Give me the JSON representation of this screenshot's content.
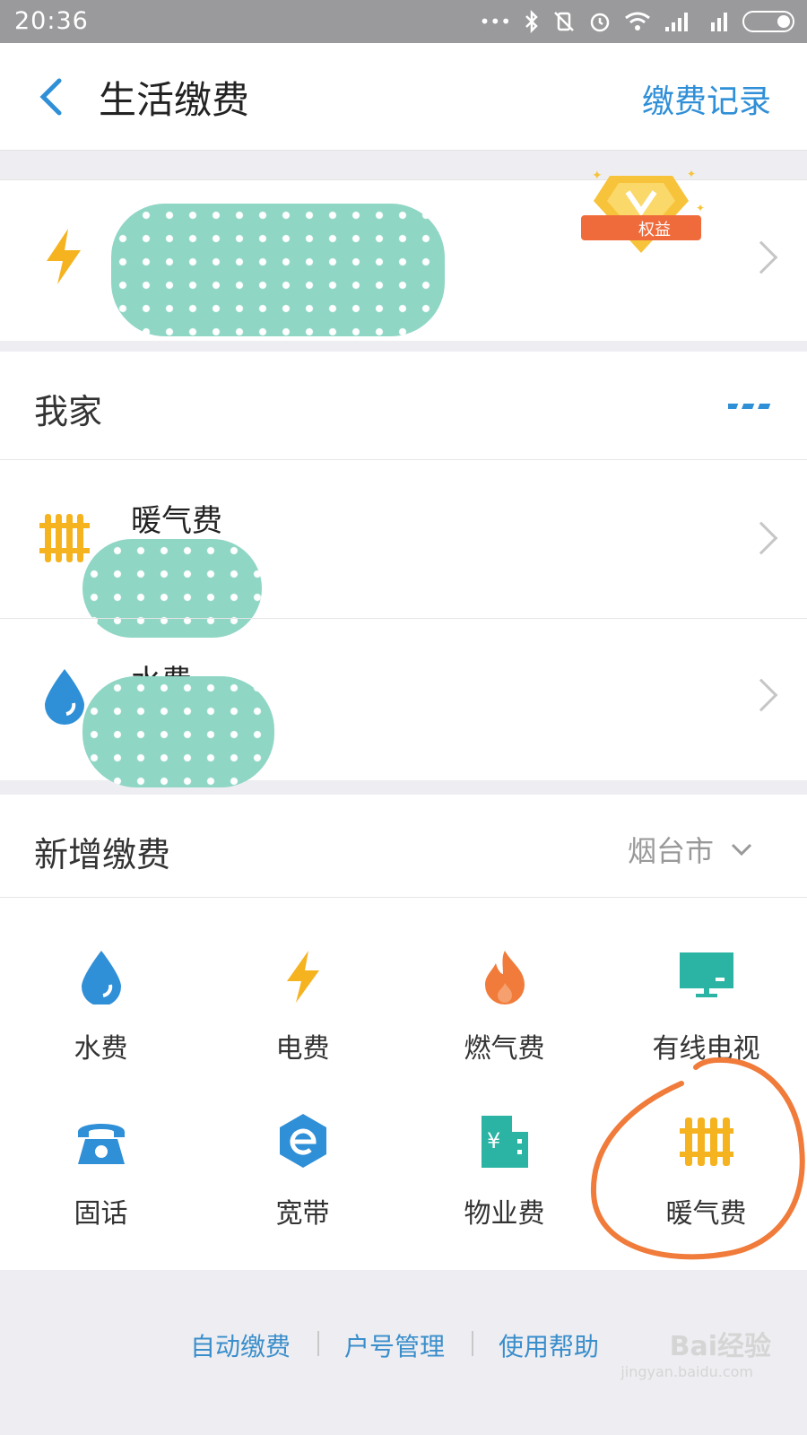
{
  "statusbar": {
    "time": "20:36"
  },
  "navbar": {
    "title": "生活缴费",
    "right_link": "缴费记录"
  },
  "top_card": {
    "label": "电",
    "badge_text": "权益"
  },
  "my_home": {
    "title": "我家",
    "items": [
      {
        "label": "暖气费"
      },
      {
        "label": "水费"
      }
    ]
  },
  "new_payment": {
    "title": "新增缴费",
    "city": "烟台市",
    "items": [
      {
        "label": "水费",
        "icon": "water-drop-icon"
      },
      {
        "label": "电费",
        "icon": "lightning-icon"
      },
      {
        "label": "燃气费",
        "icon": "flame-icon"
      },
      {
        "label": "有线电视",
        "icon": "tv-icon"
      },
      {
        "label": "固话",
        "icon": "telephone-icon"
      },
      {
        "label": "宽带",
        "icon": "broadband-icon"
      },
      {
        "label": "物业费",
        "icon": "building-icon"
      },
      {
        "label": "暖气费",
        "icon": "radiator-icon"
      }
    ]
  },
  "footer": {
    "links": [
      "自动缴费",
      "户号管理",
      "使用帮助"
    ]
  },
  "watermark": {
    "text": "Bai经验",
    "sub": "jingyan.baidu.com"
  },
  "colors": {
    "accent": "#2f8fd7",
    "yellow": "#f5b320",
    "orange": "#f07b3a",
    "teal": "#2bb3a3"
  }
}
